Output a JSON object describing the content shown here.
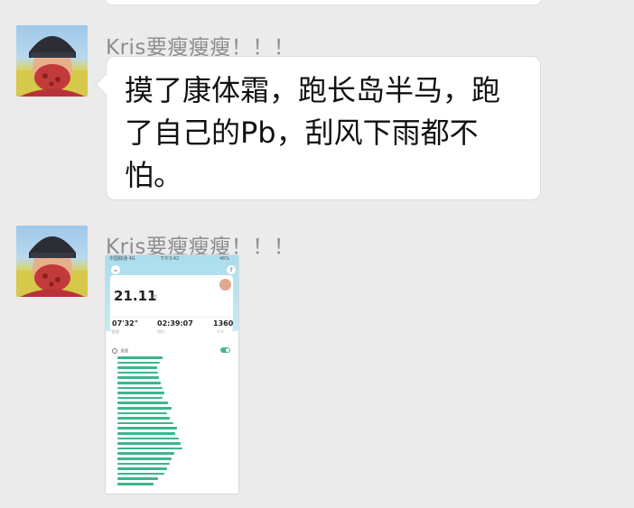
{
  "messages": [
    {
      "sender": "Kris要瘦瘦瘦！！！",
      "text": "摸了康体霜，跑长岛半马，跑了自己的Pb，刮风下雨都不怕。"
    },
    {
      "sender": "Kris要瘦瘦瘦！！！",
      "image": {
        "status_left": "中国联通 4G",
        "status_center": "下午3:42",
        "status_right": "46%",
        "distance": "21.11",
        "distance_unit": "公里",
        "pace": "07'32\"",
        "pace_label": "配速",
        "duration": "02:39:07",
        "duration_label": "用时",
        "calories": "1360",
        "calories_label": "千卡",
        "section_title": "配速",
        "split_bar_fractions": [
          0.5,
          0.47,
          0.44,
          0.45,
          0.46,
          0.48,
          0.5,
          0.52,
          0.5,
          0.56,
          0.6,
          0.55,
          0.58,
          0.62,
          0.66,
          0.64,
          0.68,
          0.7,
          0.72,
          0.63,
          0.6,
          0.58,
          0.55,
          0.52,
          0.45,
          0.4
        ]
      }
    }
  ],
  "colors": {
    "chat_background": "#ebebeb",
    "bubble": "#ffffff",
    "sender_text": "#8d8d8d",
    "split_bar": "#3cb58b"
  }
}
